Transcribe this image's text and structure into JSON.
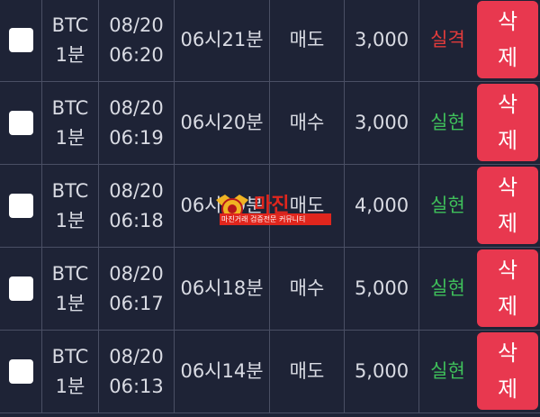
{
  "rows": [
    {
      "symbol": "BTC",
      "interval": "1분",
      "date": "08/20",
      "time": "06:20",
      "target": "06시21분",
      "side": "매도",
      "amount": "3,000",
      "result": "실격",
      "result_status": "fail",
      "delete_top": "삭",
      "delete_bottom": "제"
    },
    {
      "symbol": "BTC",
      "interval": "1분",
      "date": "08/20",
      "time": "06:19",
      "target": "06시20분",
      "side": "매수",
      "amount": "3,000",
      "result": "실현",
      "result_status": "win",
      "delete_top": "삭",
      "delete_bottom": "제"
    },
    {
      "symbol": "BTC",
      "interval": "1분",
      "date": "08/20",
      "time": "06:18",
      "target": "06시19분",
      "side": "매도",
      "amount": "4,000",
      "result": "실현",
      "result_status": "win",
      "delete_top": "삭",
      "delete_bottom": "제"
    },
    {
      "symbol": "BTC",
      "interval": "1분",
      "date": "08/20",
      "time": "06:17",
      "target": "06시18분",
      "side": "매수",
      "amount": "5,000",
      "result": "실현",
      "result_status": "win",
      "delete_top": "삭",
      "delete_bottom": "제"
    },
    {
      "symbol": "BTC",
      "interval": "1분",
      "date": "08/20",
      "time": "06:13",
      "target": "06시14분",
      "side": "매도",
      "amount": "5,000",
      "result": "실현",
      "result_status": "win",
      "delete_top": "삭",
      "delete_bottom": "제"
    }
  ],
  "watermark": {
    "logo_text": "마진",
    "tagline": "마진거래 검증전문 커뮤니티"
  },
  "colors": {
    "background": "#1e2336",
    "divider": "#4a4f64",
    "delete_button": "#e8384f",
    "result_fail": "#e23b3b",
    "result_win": "#3fbf5a"
  }
}
